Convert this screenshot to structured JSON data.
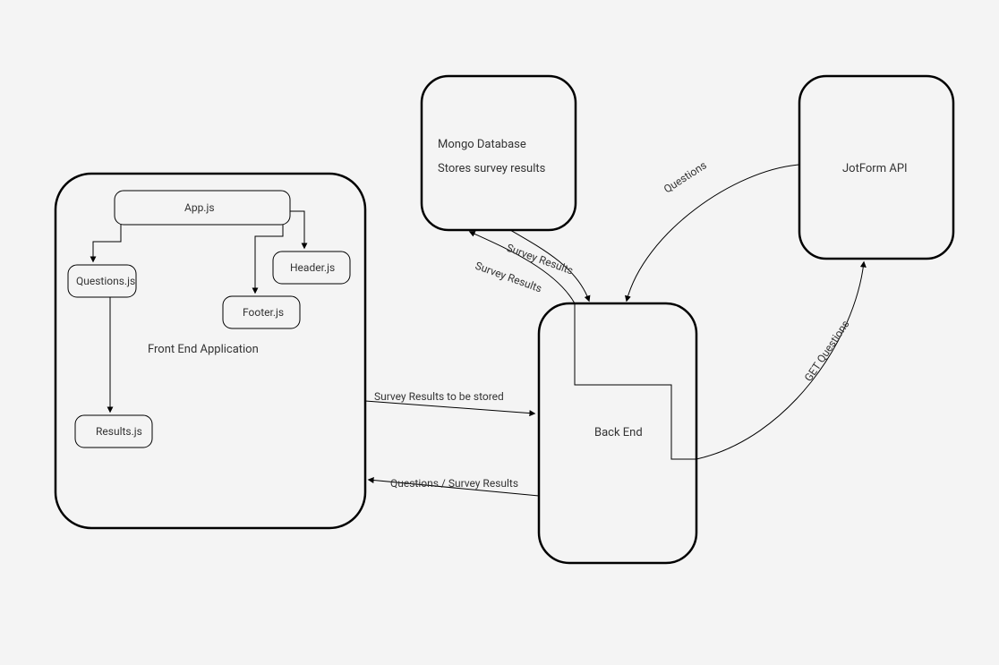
{
  "nodes": {
    "frontend_container": "Front End Application",
    "app_js": "App.js",
    "questions_js": "Questions.js",
    "header_js": "Header.js",
    "footer_js": "Footer.js",
    "results_js": "Results.js",
    "backend": "Back End",
    "mongo_line1": "Mongo Database",
    "mongo_line2": "Stores survey results",
    "jotform": "JotForm API"
  },
  "edges": {
    "fe_to_be": "Survey Results to be stored",
    "be_to_fe": "Questions / Survey Results",
    "be_to_mongo": "Survey Results",
    "mongo_to_be": "Survey Results",
    "jot_to_be": "Questions",
    "be_to_jot": "GET Questions"
  }
}
